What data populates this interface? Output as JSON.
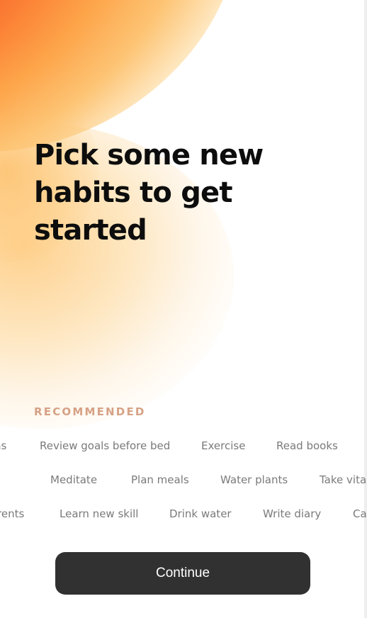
{
  "header": {
    "title": "Pick some new habits to get started"
  },
  "recommended": {
    "label": "RECOMMENDED",
    "rows": [
      [
        "ns",
        "Review goals before bed",
        "Exercise",
        "Read books"
      ],
      [
        "Meditate",
        "Plan meals",
        "Water plants",
        "Take vitan"
      ],
      [
        "rents",
        "Learn new skill",
        "Drink water",
        "Write diary",
        "Ca"
      ]
    ]
  },
  "footer": {
    "continue_label": "Continue"
  },
  "colors": {
    "accent_orange": "#fb7b33",
    "label_color": "#d6a185",
    "button_bg": "#313131"
  }
}
